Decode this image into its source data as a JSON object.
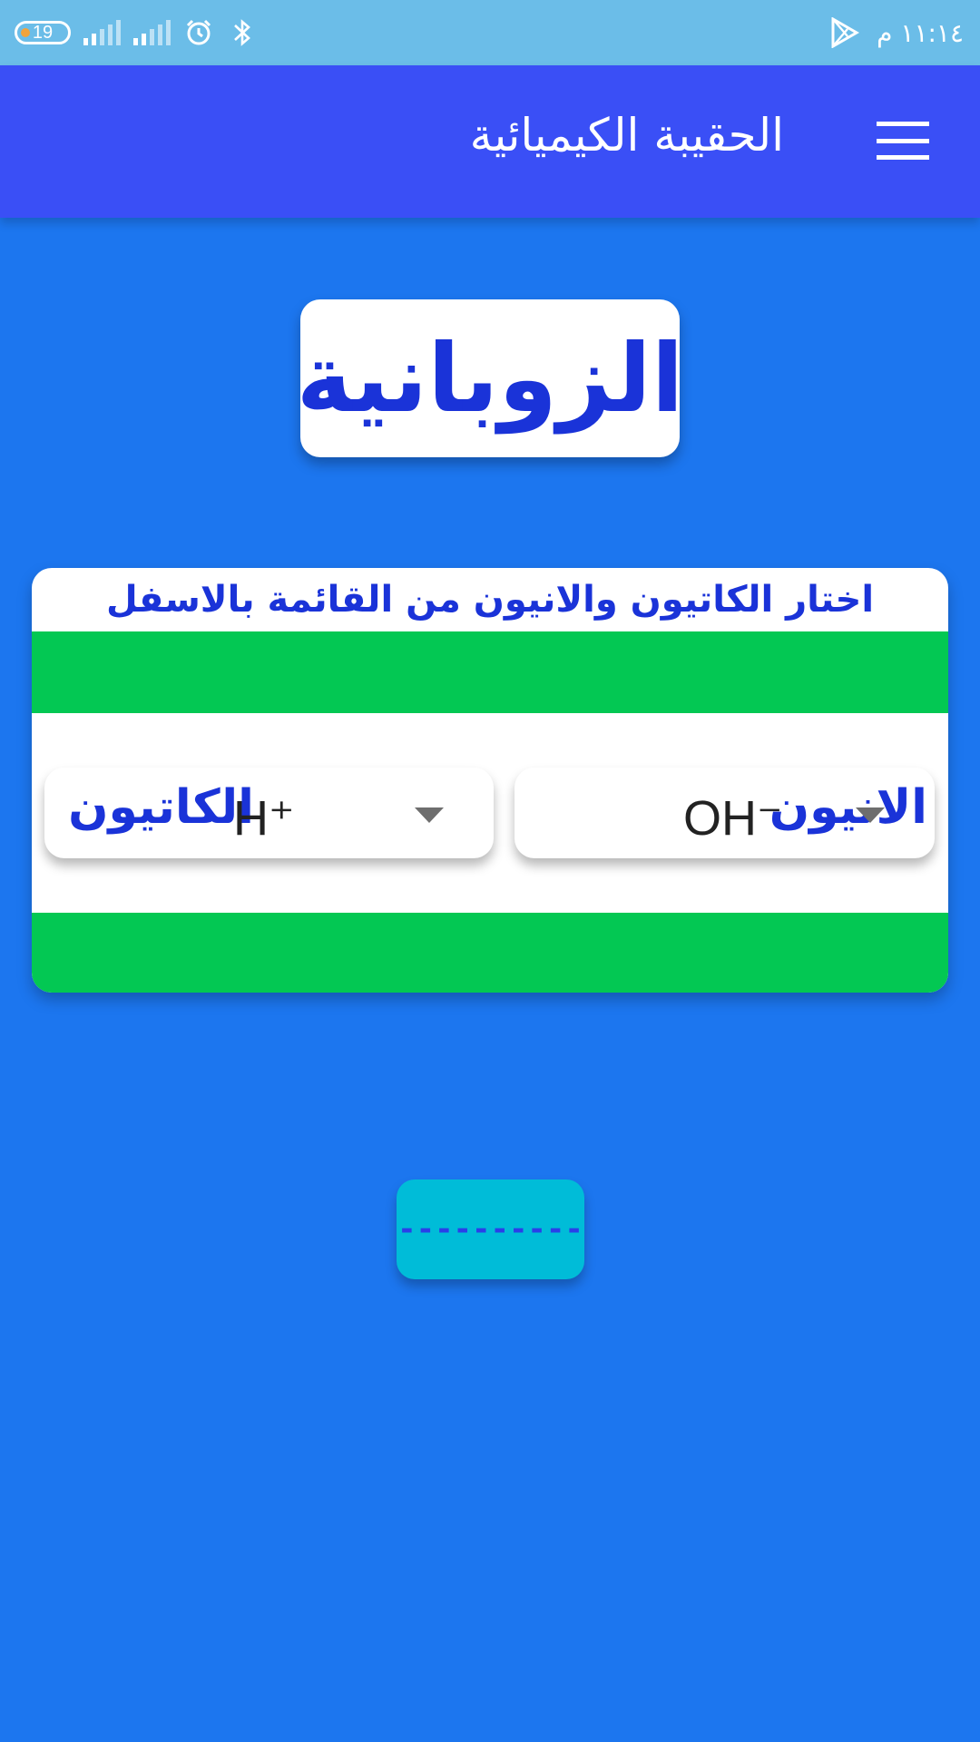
{
  "status_bar": {
    "battery_level": "19",
    "time": "١١:١٤ م",
    "icons": [
      "battery-icon",
      "signal-icon",
      "signal-icon",
      "alarm-icon",
      "bluetooth-icon",
      "play-store-icon"
    ]
  },
  "app_bar": {
    "title": "الحقيبة الكيميائية",
    "menu_icon": "hamburger-menu-icon"
  },
  "header_card": {
    "title": "الزوبانية"
  },
  "selector": {
    "instruction": "اختار الكاتيون والانيون من القائمة بالاسفل",
    "anion": {
      "label": "الانيون",
      "selected": "OH⁻"
    },
    "cation": {
      "label": "الكاتيون",
      "selected": "H⁺"
    }
  },
  "result_button": {
    "label": "----------"
  },
  "colors": {
    "background": "#1c76ef",
    "status_bar": "#6bbde8",
    "app_bar": "#3a4ff6",
    "accent_text": "#1a33d8",
    "green_bar": "#03c853",
    "button": "#00bcd8"
  }
}
